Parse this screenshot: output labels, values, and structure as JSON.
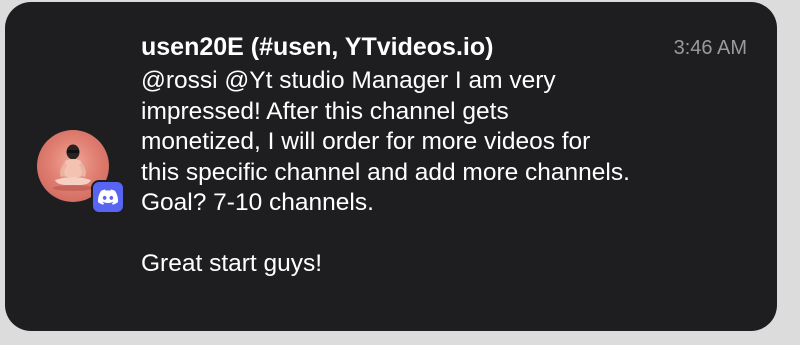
{
  "notification": {
    "sender": "usen20E (#usen, YTvideos.io)",
    "time": "3:46 AM",
    "message_lines": [
      "@rossi @Yt studio Manager  I am very",
      "impressed! After this channel gets",
      "monetized, I will order for more videos for",
      "this specific channel and add more channels.",
      "Goal? 7-10 channels."
    ],
    "message_closing": "Great start guys!",
    "app_icon": "discord-icon",
    "avatar_icon": "user-avatar"
  },
  "colors": {
    "card_bg": "#1e1e20",
    "text_primary": "#ffffff",
    "text_secondary": "#9a9a9e",
    "discord_blurple": "#5865f2",
    "avatar_bg": "#e07f72"
  }
}
